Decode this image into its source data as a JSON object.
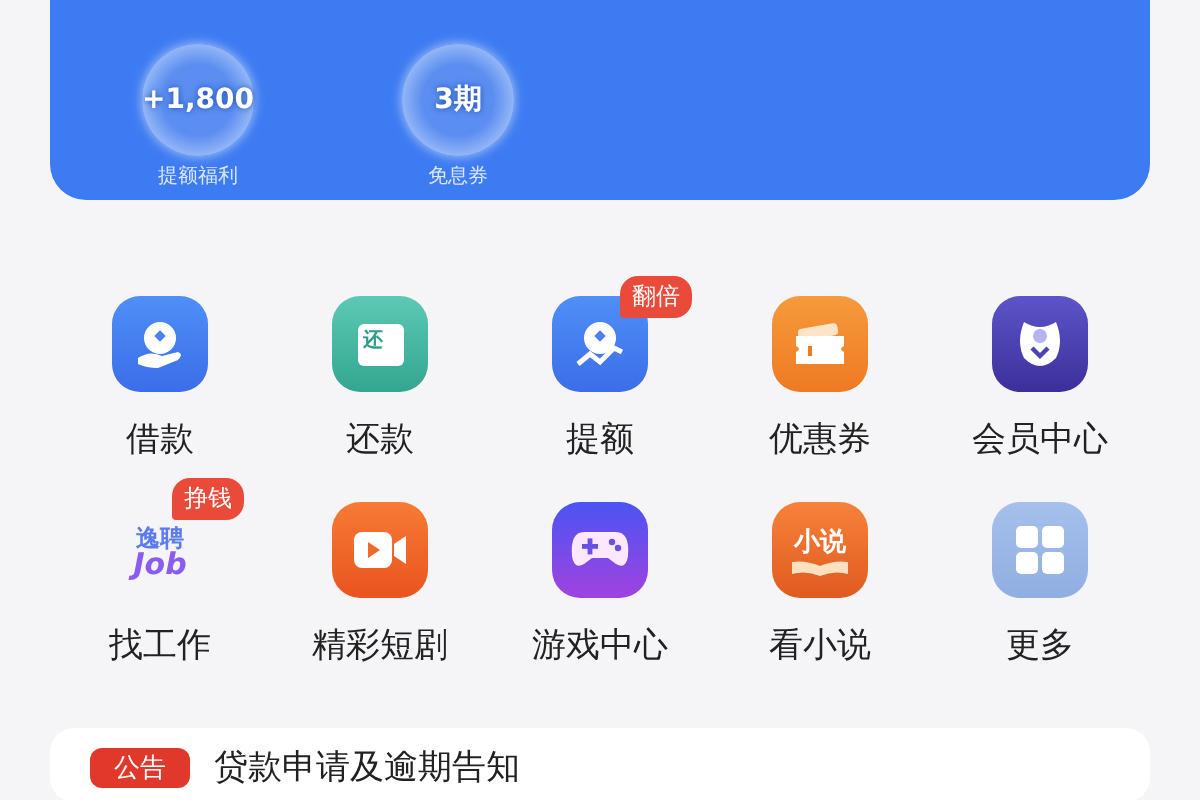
{
  "banner": {
    "perks": [
      {
        "value": "+1,800",
        "label": "提额福利"
      },
      {
        "value": "3期",
        "label": "免息券"
      }
    ]
  },
  "services": [
    {
      "kind": "loan",
      "label": "借款"
    },
    {
      "kind": "repay",
      "label": "还款",
      "icon_text": "还"
    },
    {
      "kind": "limit",
      "label": "提额",
      "badge": "翻倍"
    },
    {
      "kind": "coupon",
      "label": "优惠券"
    },
    {
      "kind": "member",
      "label": "会员中心"
    },
    {
      "kind": "job",
      "label": "找工作",
      "badge": "挣钱",
      "logo_text": [
        "逸聘",
        "Job"
      ]
    },
    {
      "kind": "drama",
      "label": "精彩短剧"
    },
    {
      "kind": "game",
      "label": "游戏中心"
    },
    {
      "kind": "novel",
      "label": "看小说",
      "icon_text": "小说"
    },
    {
      "kind": "more",
      "label": "更多"
    }
  ],
  "notice": {
    "tag": "公告",
    "text": "贷款申请及逾期告知"
  }
}
